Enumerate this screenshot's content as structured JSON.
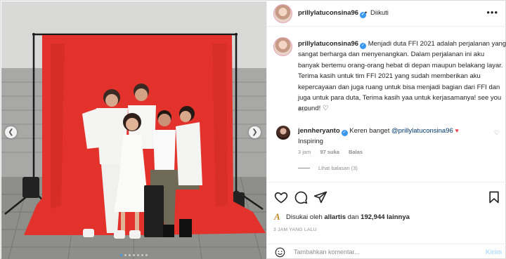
{
  "post": {
    "username": "prillylatuconsina96",
    "follow_status": "Diikuti",
    "separator": "•",
    "more_icon": "more-horizontal-icon",
    "caption": {
      "text": "Menjadi duta FFI 2021 adalah perjalanan yang sangat berharga dan menyenangkan. Dalam perjalanan ini aku banyak bertemu orang-orang hebat di depan maupun belakang layar. Terima kasih untuk tim FFI 2021 yang sudah memberikan aku kepercayaan dan juga ruang untuk bisa menjadi bagian dari FFI dan juga untuk para duta, Terima kasih yaa untuk kerjasamanya! see you around!",
      "emoji": "♡",
      "time": "3 jam"
    },
    "comment": {
      "username": "jennheryanto",
      "text_before": "Keren banget",
      "mention": "@prillylatuconsina96",
      "heart": "♥",
      "line2": "Inspiring",
      "time": "3 jam",
      "likes": "97 suka",
      "reply_label": "Balas",
      "view_replies": "Lihat balasan (3)"
    },
    "likes": {
      "prefix": "Disukai oleh",
      "first_user": "allartis",
      "middle": "dan",
      "count": "192,944 lainnya"
    },
    "post_time": "3 JAM YANG LALU",
    "add_comment": {
      "placeholder": "Tambahkan komentar...",
      "post_label": "Kirim"
    },
    "carousel": {
      "dot_count": 7,
      "active_index": 0
    },
    "colors": {
      "accent": "#3897f0",
      "backdrop": "#e8322c",
      "like_red": "#ed4956"
    }
  }
}
